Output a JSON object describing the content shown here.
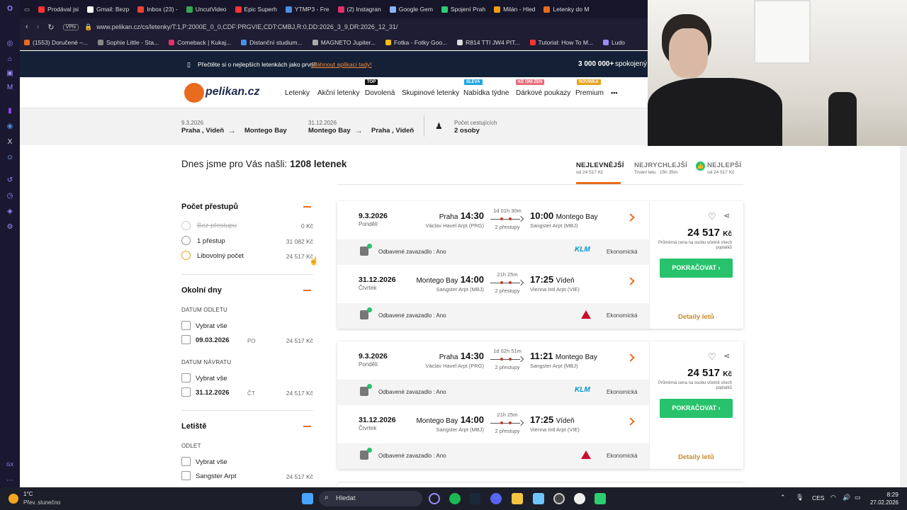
{
  "browser": {
    "tabs": [
      {
        "label": "Prodával jsi",
        "color": "#ff3333"
      },
      {
        "label": "Gmail: Bezp",
        "color": "#ffffff"
      },
      {
        "label": "Inbox (23) -",
        "color": "#ea4335"
      },
      {
        "label": "UncutVideo",
        "color": "#34a853"
      },
      {
        "label": "Epic Superh",
        "color": "#ff3333"
      },
      {
        "label": "YTMP3 - Fre",
        "color": "#4a90e2"
      },
      {
        "label": "(2) Instagran",
        "color": "#e1306c"
      },
      {
        "label": "Google Gem",
        "color": "#8ab4f8"
      },
      {
        "label": "Spojení Prah",
        "color": "#2ecc71"
      },
      {
        "label": "Milán - Hled",
        "color": "#f39c12"
      },
      {
        "label": "Letenky do M",
        "color": "#e96b1e"
      }
    ],
    "vpn": "VPN",
    "url": "www.pelikan.cz/cs/letenky/T:1,P:2000E_0_0,CDF:PRGVIE,CDT:CMBJ,R:0,DD:2026_3_9,DR:2026_12_31/",
    "bookmarks": [
      {
        "label": "(1553) Doručené –...",
        "color": "#e96b1e"
      },
      {
        "label": "Sophie Little - Sta...",
        "color": "#888888"
      },
      {
        "label": "Comeback | Kukaj...",
        "color": "#e1306c"
      },
      {
        "label": "Distanční studium...",
        "color": "#4a90e2"
      },
      {
        "label": "MAGNETO Jupiter...",
        "color": "#aaaaaa"
      },
      {
        "label": "Fotka - Fotky Goo...",
        "color": "#fbbc05"
      },
      {
        "label": "R814 TTI JW4 PIT...",
        "color": "#dddddd"
      },
      {
        "label": "Tutorial: How To M...",
        "color": "#ff3333"
      },
      {
        "label": "Ludo",
        "color": "#9a8cff"
      }
    ]
  },
  "promo": {
    "text": "Přečtěte si o nejlepších letenkách jako první!",
    "link": "Stáhnout aplikaci tady!",
    "count": "3 000 000+",
    "count_suffix": "spokojený c"
  },
  "header": {
    "logo": "pelikan.cz",
    "nav": [
      "Letenky",
      "Akční letenky",
      "Dovolená",
      "Skupinové letenky",
      "Nabídka týdne",
      "Dárkové poukazy",
      "Premium"
    ],
    "badges": {
      "dovolena": "TOP",
      "nabidka": "SLEVA",
      "darkove": "KE ONI ŽEN",
      "premium": "NOVINKA"
    },
    "more": "•••"
  },
  "search": {
    "out_date": "9.3.2026",
    "out_from": "Praha , Vídeň",
    "out_to": "Montego Bay",
    "ret_date": "31.12.2026",
    "ret_from": "Montego Bay",
    "ret_to": "Praha , Vídeň",
    "pax_label": "Počet cestujících",
    "pax_value": "2 osoby"
  },
  "results": {
    "prefix": "Dnes jsme pro Vás našli:",
    "count": "1208 letenek"
  },
  "sort": [
    {
      "title": "NEJLEVNĚJŠÍ",
      "sub": "od 24 517 Kč"
    },
    {
      "title": "NEJRYCHLEJŠÍ",
      "sub": "Trvání letu : 15h 35m"
    },
    {
      "title": "NEJLEPŠÍ",
      "sub": "od 24 517 Kč"
    }
  ],
  "filters": {
    "stops": {
      "title": "Počet přestupů",
      "items": [
        {
          "label": "Bez přestupu",
          "price": "0 Kč"
        },
        {
          "label": "1 přestup",
          "price": "31 082 Kč"
        },
        {
          "label": "Libovolný počet",
          "price": "24 517 Kč"
        }
      ]
    },
    "days": {
      "title": "Okolní dny",
      "dep_label": "DATUM ODLETU",
      "ret_label": "DATUM NÁVRATU",
      "select_all": "Vybrat vše",
      "dep_date": "09.03.2026",
      "dep_day": "PO",
      "dep_price": "24 517 Kč",
      "ret_date": "31.12.2026",
      "ret_day": "ČT",
      "ret_price": "24 517 Kč"
    },
    "airports": {
      "title": "Letiště",
      "sub": "ODLET",
      "select_all": "Vybrat vše",
      "item": "Sangster Arpt",
      "price": "24 517 Kč"
    }
  },
  "cards": [
    {
      "out": {
        "date": "9.3.2026",
        "day": "Pondělí",
        "from_city": "Praha",
        "from_time": "14:30",
        "from_ap": "Václav Havel Arpt (PRG)",
        "dur": "1d 01h 30m",
        "stops": "2 přestupy",
        "to_time": "10:00",
        "to_city": "Montego Bay",
        "to_ap": "Sangster Arpt (MBJ)"
      },
      "out_bag": {
        "text": "Odbavené zavazadlo : Ano",
        "airline": "KLM",
        "cls": "Ekonomická"
      },
      "ret": {
        "date": "31.12.2026",
        "day": "Čtvrtek",
        "from_city": "Montego Bay",
        "from_time": "14:00",
        "from_ap": "Sangster Arpt (MBJ)",
        "dur": "21h 25m",
        "stops": "2 přestupy",
        "to_time": "17:25",
        "to_city": "Vídeň",
        "to_ap": "Vienna Intl Arpt (VIE)"
      },
      "ret_bag": {
        "text": "Odbavené zavazadlo : Ano",
        "cls": "Ekonomická"
      },
      "price": "24 517",
      "currency": "Kč",
      "price_note": "Průměrná cena na osobu včetně všech poplatků",
      "button": "POKRAČOVAT",
      "details": "Detaily letů"
    },
    {
      "out": {
        "date": "9.3.2026",
        "day": "Pondělí",
        "from_city": "Praha",
        "from_time": "14:30",
        "from_ap": "Václav Havel Arpt (PRG)",
        "dur": "1d 02h 51m",
        "stops": "2 přestupy",
        "to_time": "11:21",
        "to_city": "Montego Bay",
        "to_ap": "Sangster Arpt (MBJ)"
      },
      "out_bag": {
        "text": "Odbavené zavazadlo : Ano",
        "airline": "KLM",
        "cls": "Ekonomická"
      },
      "ret": {
        "date": "31.12.2026",
        "day": "Čtvrtek",
        "from_city": "Montego Bay",
        "from_time": "14:00",
        "from_ap": "Sangster Arpt (MBJ)",
        "dur": "21h 25m",
        "stops": "2 přestupy",
        "to_time": "17:25",
        "to_city": "Vídeň",
        "to_ap": "Vienna Intl Arpt (VIE)"
      },
      "ret_bag": {
        "text": "Odbavené zavazadlo : Ano",
        "cls": "Ekonomická"
      },
      "price": "24 517",
      "currency": "Kč",
      "price_note": "Průměrná cena na osobu včetně všech poplatků",
      "button": "POKRAČOVAT",
      "details": "Detaily letů"
    }
  ],
  "taskbar": {
    "weather_temp": "1°C",
    "weather_desc": "Přev. slunečno",
    "search": "Hledat",
    "lang": "CES",
    "time": "8:29",
    "date": "27.02.2026"
  },
  "sidebar": {
    "gx": "GX"
  }
}
